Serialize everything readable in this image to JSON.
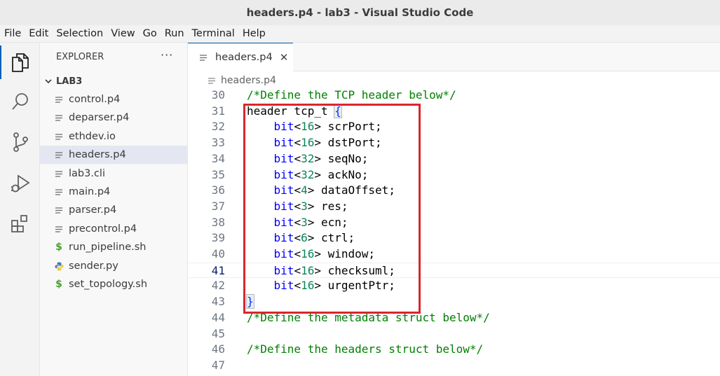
{
  "window": {
    "title": "headers.p4 - lab3 - Visual Studio Code"
  },
  "menu": [
    "File",
    "Edit",
    "Selection",
    "View",
    "Go",
    "Run",
    "Terminal",
    "Help"
  ],
  "activity_bar": {
    "icons": [
      "files-icon",
      "search-icon",
      "source-control-icon",
      "run-debug-icon",
      "extensions-icon"
    ],
    "active": "files-icon",
    "accent_color": "#005fb8"
  },
  "sidebar": {
    "header": "EXPLORER",
    "more": "···",
    "folder": "LAB3",
    "files": [
      {
        "name": "control.p4",
        "icon": "file-lines-icon",
        "selected": false
      },
      {
        "name": "deparser.p4",
        "icon": "file-lines-icon",
        "selected": false
      },
      {
        "name": "ethdev.io",
        "icon": "file-lines-icon",
        "selected": false
      },
      {
        "name": "headers.p4",
        "icon": "file-lines-icon",
        "selected": true
      },
      {
        "name": "lab3.cli",
        "icon": "file-lines-icon",
        "selected": false
      },
      {
        "name": "main.p4",
        "icon": "file-lines-icon",
        "selected": false
      },
      {
        "name": "parser.p4",
        "icon": "file-lines-icon",
        "selected": false
      },
      {
        "name": "precontrol.p4",
        "icon": "file-lines-icon",
        "selected": false
      },
      {
        "name": "run_pipeline.sh",
        "icon": "dollar-icon",
        "selected": false
      },
      {
        "name": "sender.py",
        "icon": "python-icon",
        "selected": false
      },
      {
        "name": "set_topology.sh",
        "icon": "dollar-icon",
        "selected": false
      }
    ]
  },
  "tabs": [
    {
      "label": "headers.p4",
      "close": "✕",
      "active": true
    }
  ],
  "breadcrumb": {
    "label": "headers.p4"
  },
  "editor": {
    "current_line": 41,
    "lines": [
      {
        "n": "30",
        "tokens": [
          {
            "t": "/*Define the TCP header below*/",
            "c": "comment"
          }
        ]
      },
      {
        "n": "31",
        "tokens": [
          {
            "t": "header tcp_t ",
            "c": "plain"
          },
          {
            "t": "{",
            "c": "brace"
          }
        ]
      },
      {
        "n": "32",
        "tokens": [
          {
            "t": "    ",
            "c": "plain"
          },
          {
            "t": "bit",
            "c": "type"
          },
          {
            "t": "<",
            "c": "plain"
          },
          {
            "t": "16",
            "c": "num"
          },
          {
            "t": "> scrPort;",
            "c": "plain"
          }
        ]
      },
      {
        "n": "33",
        "tokens": [
          {
            "t": "    ",
            "c": "plain"
          },
          {
            "t": "bit",
            "c": "type"
          },
          {
            "t": "<",
            "c": "plain"
          },
          {
            "t": "16",
            "c": "num"
          },
          {
            "t": "> dstPort;",
            "c": "plain"
          }
        ]
      },
      {
        "n": "34",
        "tokens": [
          {
            "t": "    ",
            "c": "plain"
          },
          {
            "t": "bit",
            "c": "type"
          },
          {
            "t": "<",
            "c": "plain"
          },
          {
            "t": "32",
            "c": "num"
          },
          {
            "t": "> seqNo;",
            "c": "plain"
          }
        ]
      },
      {
        "n": "35",
        "tokens": [
          {
            "t": "    ",
            "c": "plain"
          },
          {
            "t": "bit",
            "c": "type"
          },
          {
            "t": "<",
            "c": "plain"
          },
          {
            "t": "32",
            "c": "num"
          },
          {
            "t": "> ackNo;",
            "c": "plain"
          }
        ]
      },
      {
        "n": "36",
        "tokens": [
          {
            "t": "    ",
            "c": "plain"
          },
          {
            "t": "bit",
            "c": "type"
          },
          {
            "t": "<",
            "c": "plain"
          },
          {
            "t": "4",
            "c": "num"
          },
          {
            "t": "> dataOffset;",
            "c": "plain"
          }
        ]
      },
      {
        "n": "37",
        "tokens": [
          {
            "t": "    ",
            "c": "plain"
          },
          {
            "t": "bit",
            "c": "type"
          },
          {
            "t": "<",
            "c": "plain"
          },
          {
            "t": "3",
            "c": "num"
          },
          {
            "t": "> res;",
            "c": "plain"
          }
        ]
      },
      {
        "n": "38",
        "tokens": [
          {
            "t": "    ",
            "c": "plain"
          },
          {
            "t": "bit",
            "c": "type"
          },
          {
            "t": "<",
            "c": "plain"
          },
          {
            "t": "3",
            "c": "num"
          },
          {
            "t": "> ecn;",
            "c": "plain"
          }
        ]
      },
      {
        "n": "39",
        "tokens": [
          {
            "t": "    ",
            "c": "plain"
          },
          {
            "t": "bit",
            "c": "type"
          },
          {
            "t": "<",
            "c": "plain"
          },
          {
            "t": "6",
            "c": "num"
          },
          {
            "t": "> ctrl;",
            "c": "plain"
          }
        ]
      },
      {
        "n": "40",
        "tokens": [
          {
            "t": "    ",
            "c": "plain"
          },
          {
            "t": "bit",
            "c": "type"
          },
          {
            "t": "<",
            "c": "plain"
          },
          {
            "t": "16",
            "c": "num"
          },
          {
            "t": "> window;",
            "c": "plain"
          }
        ]
      },
      {
        "n": "41",
        "tokens": [
          {
            "t": "    ",
            "c": "plain"
          },
          {
            "t": "bit",
            "c": "type"
          },
          {
            "t": "<",
            "c": "plain"
          },
          {
            "t": "16",
            "c": "num"
          },
          {
            "t": "> checksuml;",
            "c": "plain"
          }
        ]
      },
      {
        "n": "42",
        "tokens": [
          {
            "t": "    ",
            "c": "plain"
          },
          {
            "t": "bit",
            "c": "type"
          },
          {
            "t": "<",
            "c": "plain"
          },
          {
            "t": "16",
            "c": "num"
          },
          {
            "t": "> urgentPtr;",
            "c": "plain"
          }
        ]
      },
      {
        "n": "43",
        "tokens": [
          {
            "t": "}",
            "c": "brace"
          }
        ]
      },
      {
        "n": "44",
        "tokens": [
          {
            "t": "/*Define the metadata struct below*/",
            "c": "comment"
          }
        ]
      },
      {
        "n": "45",
        "tokens": []
      },
      {
        "n": "46",
        "tokens": [
          {
            "t": "/*Define the headers struct below*/",
            "c": "comment"
          }
        ]
      },
      {
        "n": "47",
        "tokens": []
      }
    ]
  },
  "colors": {
    "comment": "#008000",
    "type": "#0000ff",
    "number": "#098658",
    "highlight_box": "#d9262b"
  }
}
